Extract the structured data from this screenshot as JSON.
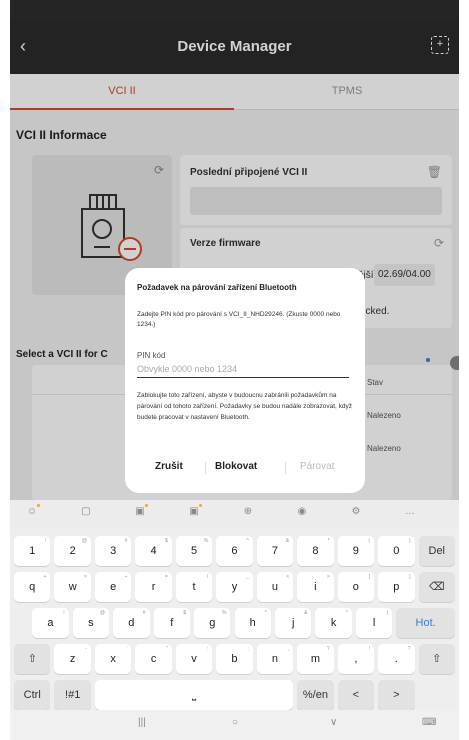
{
  "appbar": {
    "back_icon": "chevron-left-icon",
    "title": "Device Manager",
    "scan_icon": "scan-icon"
  },
  "tabs": [
    {
      "label": "VCI II",
      "active": true
    },
    {
      "label": "TPMS",
      "active": false
    }
  ],
  "section_title": "VCI II Informace",
  "last_connected": {
    "label": "Poslední připojené VCI II"
  },
  "firmware": {
    "label": "Verze firmware",
    "version_prefix": "ější",
    "version": "02.69/04.00",
    "checked_text": "ecked."
  },
  "select_label": "Select a VCI II for C",
  "list": {
    "status_header": "Stav",
    "rows": [
      "Nalezeno",
      "Nalezeno"
    ]
  },
  "dialog": {
    "title": "Požadavek na párování zařízení Bluetooth",
    "message": "Zadejte PIN kód pro párování s VCI_II_NHD29246. (Zkuste 0000 nebo 1234.)",
    "pin_label": "PIN kód",
    "pin_placeholder": "Obvykle 0000 nebo 1234",
    "pin_value": "",
    "note": "Zablokujte toto zařízení, abyste v budoucnu zabránili požadavkům na párování od tohoto zařízení. Požadavky se budou nadále zobrazovat, když budete pracovat v nastavení Bluetooth.",
    "cancel": "Zrušit",
    "block": "Blokovat",
    "pair": "Párovat"
  },
  "keyboard": {
    "toolbar_icons": [
      "emoji-icon",
      "clipboard-icon",
      "gif-icon",
      "sticker-icon",
      "translate-icon",
      "mic-icon",
      "settings-icon",
      "more-icon"
    ],
    "row1": [
      {
        "k": "1",
        "s": "!"
      },
      {
        "k": "2",
        "s": "@"
      },
      {
        "k": "3",
        "s": "#"
      },
      {
        "k": "4",
        "s": "$"
      },
      {
        "k": "5",
        "s": "%"
      },
      {
        "k": "6",
        "s": "^"
      },
      {
        "k": "7",
        "s": "&"
      },
      {
        "k": "8",
        "s": "*"
      },
      {
        "k": "9",
        "s": "("
      },
      {
        "k": "0",
        "s": ")"
      },
      {
        "k": "Del",
        "s": ""
      }
    ],
    "row2": [
      {
        "k": "q",
        "s": "+"
      },
      {
        "k": "w",
        "s": "×"
      },
      {
        "k": "e",
        "s": "÷"
      },
      {
        "k": "r",
        "s": "="
      },
      {
        "k": "t",
        "s": "/"
      },
      {
        "k": "y",
        "s": "_"
      },
      {
        "k": "u",
        "s": "<"
      },
      {
        "k": "i",
        "s": ">"
      },
      {
        "k": "o",
        "s": "["
      },
      {
        "k": "p",
        "s": "]"
      },
      {
        "k": "⌫",
        "s": ""
      }
    ],
    "row3": [
      {
        "k": "a",
        "s": "!"
      },
      {
        "k": "s",
        "s": "@"
      },
      {
        "k": "d",
        "s": "#"
      },
      {
        "k": "f",
        "s": "$"
      },
      {
        "k": "g",
        "s": "%"
      },
      {
        "k": "h",
        "s": "^"
      },
      {
        "k": "j",
        "s": "&"
      },
      {
        "k": "k",
        "s": "*"
      },
      {
        "k": "l",
        "s": "("
      },
      {
        "k": "Hot.",
        "s": ""
      }
    ],
    "row4": [
      {
        "k": "⇧",
        "s": ""
      },
      {
        "k": "z",
        "s": "-"
      },
      {
        "k": "x",
        "s": "'"
      },
      {
        "k": "c",
        "s": "\""
      },
      {
        "k": "v",
        "s": ":"
      },
      {
        "k": "b",
        "s": ";"
      },
      {
        "k": "n",
        "s": ","
      },
      {
        "k": "m",
        "s": "?"
      },
      {
        "k": ",",
        "s": "!"
      },
      {
        "k": ".",
        "s": "?"
      },
      {
        "k": "⇧",
        "s": ""
      }
    ],
    "row5": [
      {
        "k": "Ctrl",
        "s": ""
      },
      {
        "k": "!#1",
        "s": ""
      },
      {
        "k": "⎵",
        "s": ""
      },
      {
        "k": "%/en",
        "s": ""
      },
      {
        "k": "<",
        "s": ""
      },
      {
        "k": ">",
        "s": ""
      }
    ]
  },
  "nav": {
    "recent": "|||",
    "home": "○",
    "back": "∨",
    "keyboard": "⌨"
  },
  "colors": {
    "accent": "#d34b2a",
    "appbar": "#2b2b2b",
    "link": "#3a7bd5"
  }
}
